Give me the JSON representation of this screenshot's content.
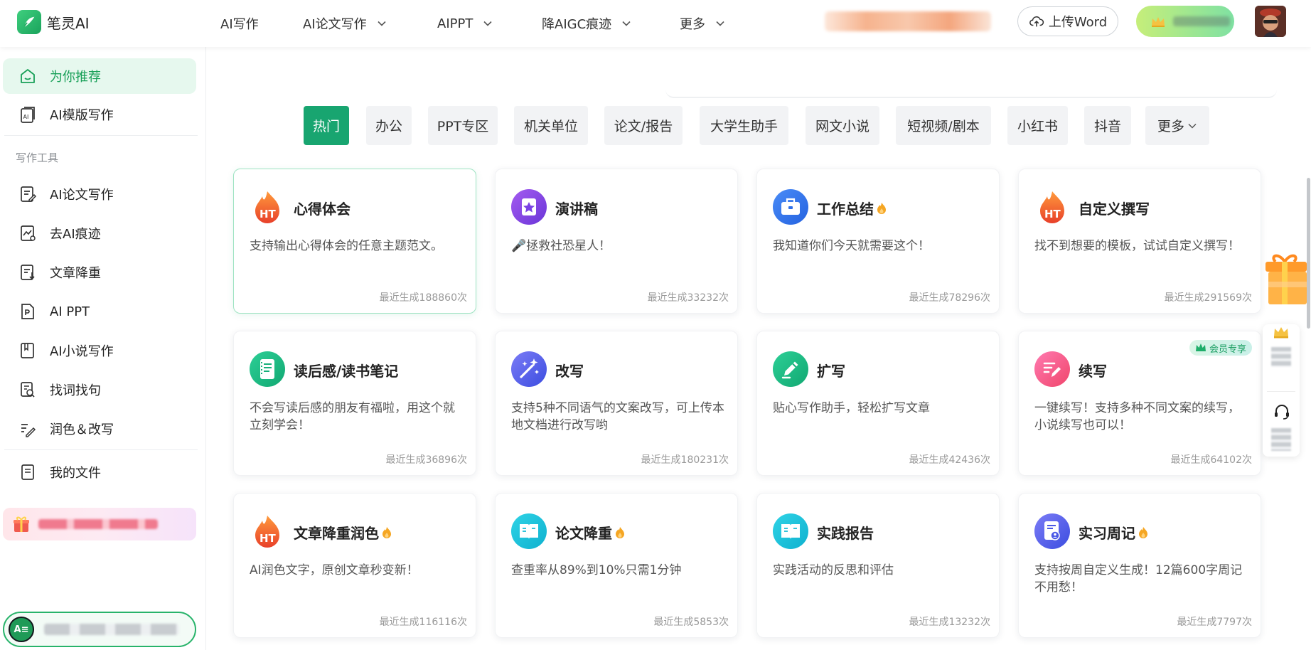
{
  "app": {
    "name": "笔灵AI"
  },
  "nav": [
    {
      "label": "AI写作",
      "dropdown": false
    },
    {
      "label": "AI论文写作",
      "dropdown": true
    },
    {
      "label": "AIPPT",
      "dropdown": true
    },
    {
      "label": "降AIGC痕迹",
      "dropdown": true
    },
    {
      "label": "更多",
      "dropdown": true
    }
  ],
  "header": {
    "upload_label": "上传Word"
  },
  "sidebar": {
    "top_items": [
      {
        "label": "为你推荐",
        "icon": "home-icon",
        "active": true
      },
      {
        "label": "AI模版写作",
        "icon": "ai-template-icon",
        "active": false
      }
    ],
    "group_title": "写作工具",
    "tool_items": [
      {
        "label": "AI论文写作",
        "icon": "paper-write-icon"
      },
      {
        "label": "去AI痕迹",
        "icon": "remove-ai-trace-icon"
      },
      {
        "label": "文章降重",
        "icon": "reduce-duplicate-icon"
      },
      {
        "label": "AI PPT",
        "icon": "ppt-file-icon"
      },
      {
        "label": "AI小说写作",
        "icon": "novel-book-icon"
      },
      {
        "label": "找词找句",
        "icon": "find-phrase-icon"
      },
      {
        "label": "润色＆改写",
        "icon": "polish-icon"
      }
    ],
    "files_item": {
      "label": "我的文件",
      "icon": "my-files-icon"
    },
    "account_avatar_text": "A≡"
  },
  "categories": [
    {
      "label": "热门",
      "active": true
    },
    {
      "label": "办公"
    },
    {
      "label": "PPT专区"
    },
    {
      "label": "机关单位"
    },
    {
      "label": "论文/报告"
    },
    {
      "label": "大学生助手"
    },
    {
      "label": "网文小说"
    },
    {
      "label": "短视频/剧本"
    },
    {
      "label": "小红书"
    },
    {
      "label": "抖音"
    },
    {
      "label": "更多",
      "dropdown": true
    }
  ],
  "cards": [
    {
      "title": "心得体会",
      "desc": "支持输出心得体会的任意主题范文。",
      "count": "最近生成188860次",
      "icon": "ht-flame-icon",
      "hot": false,
      "selected": true
    },
    {
      "title": "演讲稿",
      "desc": "🎤拯救社恐星人！",
      "count": "最近生成33232次",
      "icon": "star-badge-icon",
      "hot": false
    },
    {
      "title": "工作总结",
      "desc": "我知道你们今天就需要这个！",
      "count": "最近生成78296次",
      "icon": "briefcase-icon",
      "hot": true
    },
    {
      "title": "自定义撰写",
      "desc": "找不到想要的模板，试试自定义撰写！",
      "count": "最近生成291569次",
      "icon": "ht-flame-icon",
      "hot": false
    },
    {
      "title": "读后感/读书笔记",
      "desc": "不会写读后感的朋友有福啦，用这个就立刻学会！",
      "count": "最近生成36896次",
      "icon": "notebook-icon",
      "hot": false
    },
    {
      "title": "改写",
      "desc": "支持5种不同语气的文案改写，可上传本地文档进行改写哟",
      "count": "最近生成180231次",
      "icon": "magic-wand-icon",
      "hot": false
    },
    {
      "title": "扩写",
      "desc": "贴心写作助手，轻松扩写文章",
      "count": "最近生成42436次",
      "icon": "pencil-icon",
      "hot": false
    },
    {
      "title": "续写",
      "desc": "一键续写！支持多种不同文案的续写，小说续写也可以！",
      "count": "最近生成64102次",
      "icon": "continue-write-icon",
      "hot": false,
      "badge": "会员专享"
    },
    {
      "title": "文章降重润色",
      "desc": "AI润色文字，原创文章秒变新！",
      "count": "最近生成116116次",
      "icon": "ht-flame-icon",
      "hot": true
    },
    {
      "title": "论文降重",
      "desc": "查重率从89%到10%只需1分钟",
      "count": "最近生成5853次",
      "icon": "open-book-icon",
      "hot": true
    },
    {
      "title": "实践报告",
      "desc": "实践活动的反思和评估",
      "count": "最近生成13232次",
      "icon": "open-book-icon",
      "hot": false
    },
    {
      "title": "实习周记",
      "desc": "支持按周自定义生成！12篇600字周记不用愁！",
      "count": "最近生成7797次",
      "icon": "intern-report-icon",
      "hot": true
    }
  ],
  "colors": {
    "brand": "#18a570",
    "active_bg": "#e6f8ee",
    "hot": "#f5a623"
  }
}
